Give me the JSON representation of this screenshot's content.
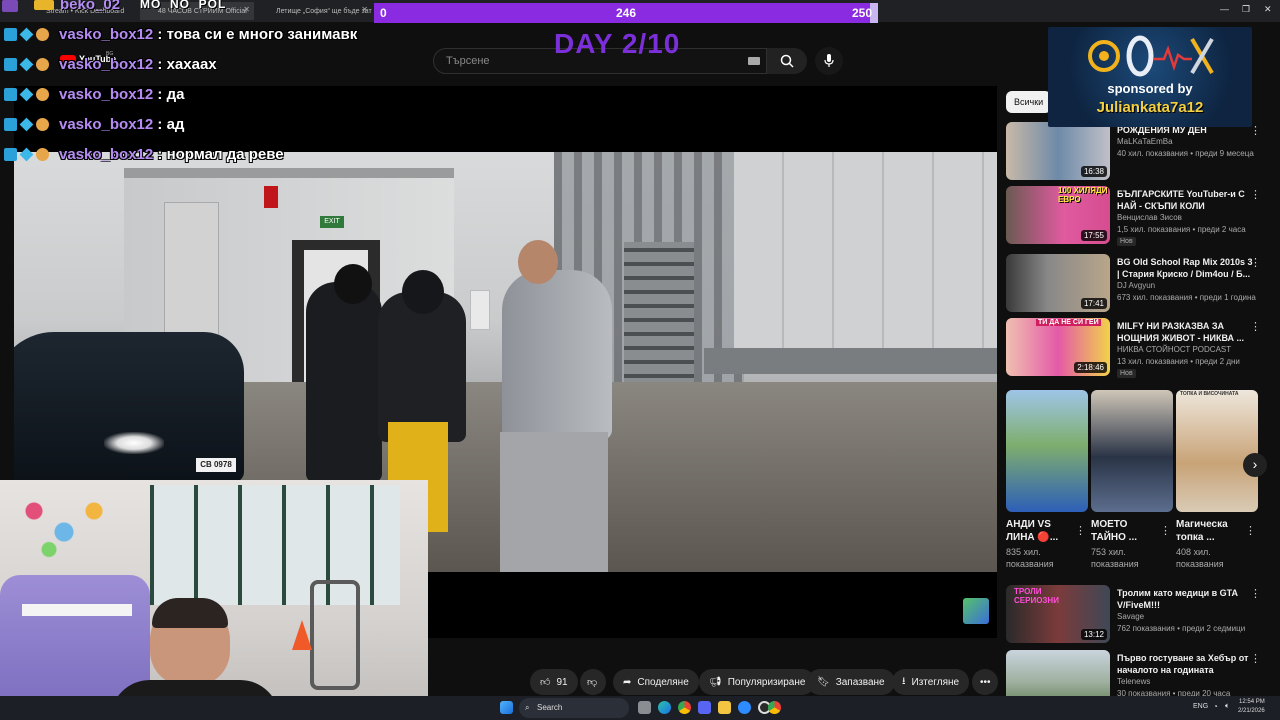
{
  "browser": {
    "tabs": [
      {
        "label": "Stream • Kick Dashboard"
      },
      {
        "label": "48 ЧАСОВ СТРИЙМ Official"
      },
      {
        "label": "Летище „София“ ще бъде зат"
      }
    ]
  },
  "youtube": {
    "search_placeholder": "Търсене",
    "logo_text": "YouTube",
    "logo_region": "BG"
  },
  "stream_overlay": {
    "top_name": "beko_02",
    "top_name_suffix": "MO  NO  POL",
    "progress": {
      "current": "246",
      "goal": "250",
      "fraction": 0.984
    },
    "day_label": "DAY 2/10",
    "chat": [
      {
        "user": "vasko_box12",
        "message": "това си е много занимавк"
      },
      {
        "user": "vasko_box12",
        "message": "хахаах"
      },
      {
        "user": "vasko_box12",
        "message": "да"
      },
      {
        "user": "vasko_box12",
        "message": "ад"
      },
      {
        "user": "vasko_box12",
        "message": "нормал да реве"
      }
    ],
    "sponsor": {
      "line1": "sponsored by",
      "line2": "Juliankata7a12"
    }
  },
  "video": {
    "scene_sign": "EXIT",
    "plate": "CB 0978"
  },
  "actions": {
    "likes": "91",
    "share": "Споделяне",
    "promote": "Популяризиране",
    "save": "Запазване",
    "download": "Изтегляне"
  },
  "sidebar": {
    "chip_all": "Всички",
    "recommendations": [
      {
        "title": "РОЖДЕНИЯ МУ ДЕН",
        "channel": "MaLKaTaEmBa",
        "meta": "40 хил. показвания • преди 9 месеца",
        "duration": "16:38",
        "badge": ""
      },
      {
        "title": "БЪЛГАРСКИТЕ YouTuber-и С НАЙ - СКЪПИ КОЛИ",
        "channel": "Венцислав Зисов",
        "meta": "1,5 хил. показвания • преди 2 часа",
        "duration": "17:55",
        "badge": "Нов",
        "thumb_text": "100 ХИЛЯДИ ЕВРО"
      },
      {
        "title": "BG Old School Rap Mix 2010s 3 | Стария Криско / Dim4ou / Б...",
        "channel": "DJ Avgyun",
        "meta": "673 хил. показвания • преди 1 година",
        "duration": "17:41",
        "badge": ""
      },
      {
        "title": "MILFY НИ РАЗКАЗВА ЗА НОЩНИЯ ЖИВОТ - НИКВА ...",
        "channel": "НИКВА СТОЙНОСТ PODCAST",
        "meta": "13 хил. показвания • преди 2 дни",
        "duration": "2:18:46",
        "badge": "Нов",
        "thumb_text": "ТИ ДА НЕ СИ ГЕЙ"
      },
      {
        "title": "Тролим като медици в GTA V/FiveM!!!",
        "channel": "Savage",
        "meta": "762 показвания • преди 2 седмици",
        "duration": "13:12",
        "badge": "",
        "thumb_text": "ТРОЛИ СЕРИОЗНИ"
      },
      {
        "title": "Първо гостуване за Хебър от началото на годината",
        "channel": "Telenews",
        "meta": "30 показвания • преди 20 часа",
        "duration": "",
        "badge": ""
      }
    ],
    "shorts": [
      {
        "title": "АНДИ VS ЛИНА 🔴...",
        "views": "835 хил. показвания"
      },
      {
        "title": "МОЕТО ТАЙНО ...",
        "views": "753 хил. показвания"
      },
      {
        "title": "Магическа топка ...",
        "views": "408 хил. показвания",
        "thumb_text": "ТОПКА И ВИСОЧИНАТА"
      }
    ]
  },
  "taskbar": {
    "search": "Search",
    "lang": "ENG",
    "time": "12:54 PM",
    "date": "2/21/2026"
  },
  "colors": {
    "accent_purple": "#8a2be2",
    "chat_user": "#b58cf3",
    "sponsor_name": "#f5d040"
  }
}
